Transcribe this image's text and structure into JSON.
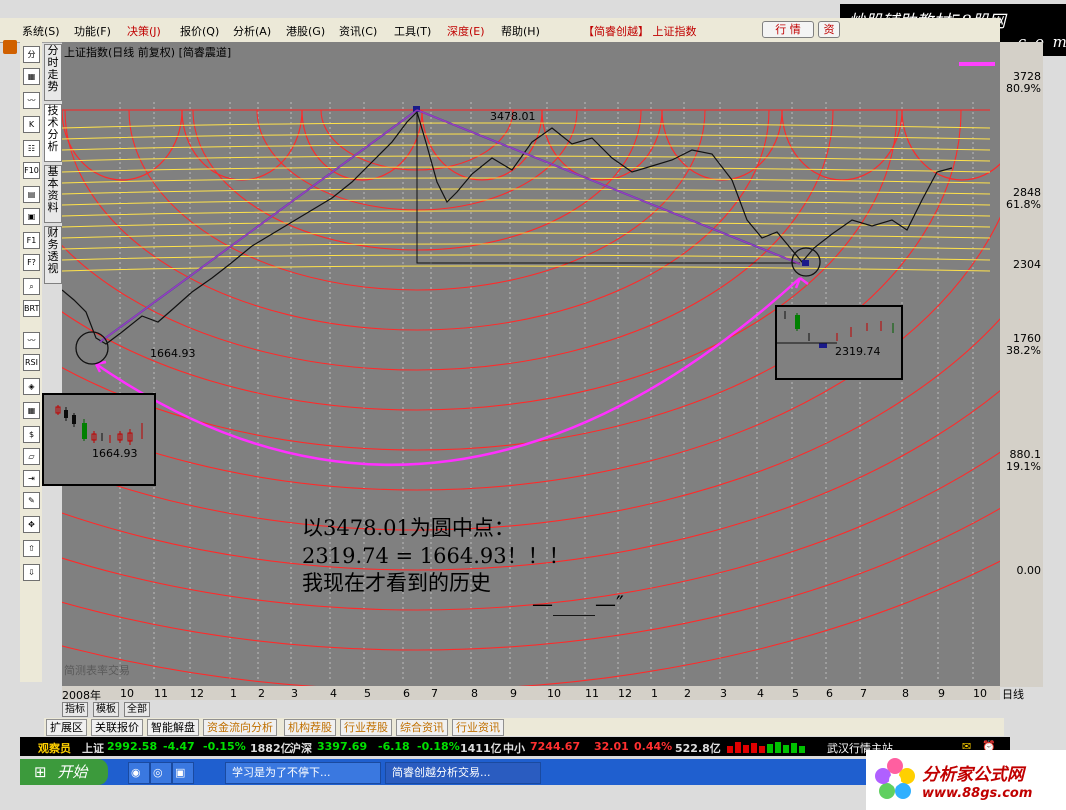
{
  "menu": {
    "items": [
      {
        "label": "系统(S)",
        "red": false
      },
      {
        "label": "功能(F)",
        "red": false
      },
      {
        "label": "决策(J)",
        "red": true
      },
      {
        "label": "报价(Q)",
        "red": false
      },
      {
        "label": "分析(A)",
        "red": false
      },
      {
        "label": "港股(G)",
        "red": false
      },
      {
        "label": "资讯(C)",
        "red": false
      },
      {
        "label": "工具(T)",
        "red": false
      },
      {
        "label": "深度(E)",
        "red": true
      },
      {
        "label": "帮助(H)",
        "red": false
      }
    ],
    "product": "【简睿创越】 上证指数",
    "btn_hangqing": "行 情",
    "btn_zi": "资"
  },
  "watermark_top": {
    "line1": "炒股辅助教材58股网",
    "line2": "w w w . 5 8 G u . c o m"
  },
  "watermark_bottom": {
    "line1": "分析家公式网",
    "line2": "www.88gs.com"
  },
  "chart": {
    "title": "上证指数(日线 前复权) [简睿震道]",
    "peak_label": "3478.01",
    "low_label": "1664.93",
    "inset_left_label": "1664.93",
    "inset_right_label": "2319.74",
    "footer_watermark": "简测表率交易",
    "annotation": [
      "以3478.01为圆中点：",
      "2319.74 = 1664.93！！！",
      "我现在才看到的历史",
      "—____—″"
    ]
  },
  "right_axis": {
    "labels": [
      {
        "price": "3728",
        "pct": "80.9%"
      },
      {
        "price": "2848",
        "pct": "61.8%"
      },
      {
        "price": "2304",
        "pct": ""
      },
      {
        "price": "1760",
        "pct": "38.2%"
      },
      {
        "price": "880.1",
        "pct": "19.1%"
      },
      {
        "price": "0.00",
        "pct": ""
      }
    ]
  },
  "x_axis": {
    "labels": [
      "2008年",
      "10",
      "11",
      "12",
      "1",
      "2",
      "3",
      "4",
      "5",
      "6",
      "7",
      "8",
      "9",
      "10",
      "11",
      "12",
      "1",
      "2",
      "3",
      "4",
      "5",
      "6",
      "7",
      "8",
      "9",
      "10"
    ],
    "period": "日线"
  },
  "left_tools": [
    "分",
    "▦",
    "〰",
    "K",
    "☷",
    "F10",
    "▤",
    "▣",
    "F1",
    "F?",
    "⌕",
    "BRT",
    "〰",
    "RSI",
    "◈",
    "▦",
    "$",
    "▱",
    "⇥",
    "✎",
    "✥",
    "⇧",
    "⇩"
  ],
  "vertical_tabs": [
    "分时走势",
    "技术分析",
    "基本资料",
    "财务透视"
  ],
  "sub_tabs": [
    "指标",
    "模板",
    "全部"
  ],
  "bottom_tabs": [
    {
      "label": "扩展区",
      "orange": false
    },
    {
      "label": "关联报价",
      "orange": false
    },
    {
      "label": "智能解盘",
      "orange": false
    },
    {
      "label": "资金流向分析",
      "orange": true
    },
    {
      "label": "机构荐股",
      "orange": true
    },
    {
      "label": "行业荐股",
      "orange": true
    },
    {
      "label": "综合资讯",
      "orange": true
    },
    {
      "label": "行业资讯",
      "orange": true
    }
  ],
  "ticker": {
    "watcher": "观察员",
    "sh_name": "上证",
    "sh_value": "2992.58",
    "sh_change": "-4.47",
    "sh_pct": "-0.15%",
    "sh_vol": "1882亿",
    "sz_name": "沪深",
    "sz_value": "3397.69",
    "sz_change": "-6.18",
    "sz_pct": "-0.18%",
    "sz_vol": "1411亿",
    "zx_name": "中小",
    "zx_value": "7244.67",
    "zx_change": "32.01",
    "zx_pct": "0.44%",
    "zx_vol": "522.8亿",
    "station": "武汉行情主站"
  },
  "taskbar": {
    "start": "开始",
    "tasks": [
      "学习是为了不停下...",
      "简睿创越分析交易..."
    ]
  }
}
